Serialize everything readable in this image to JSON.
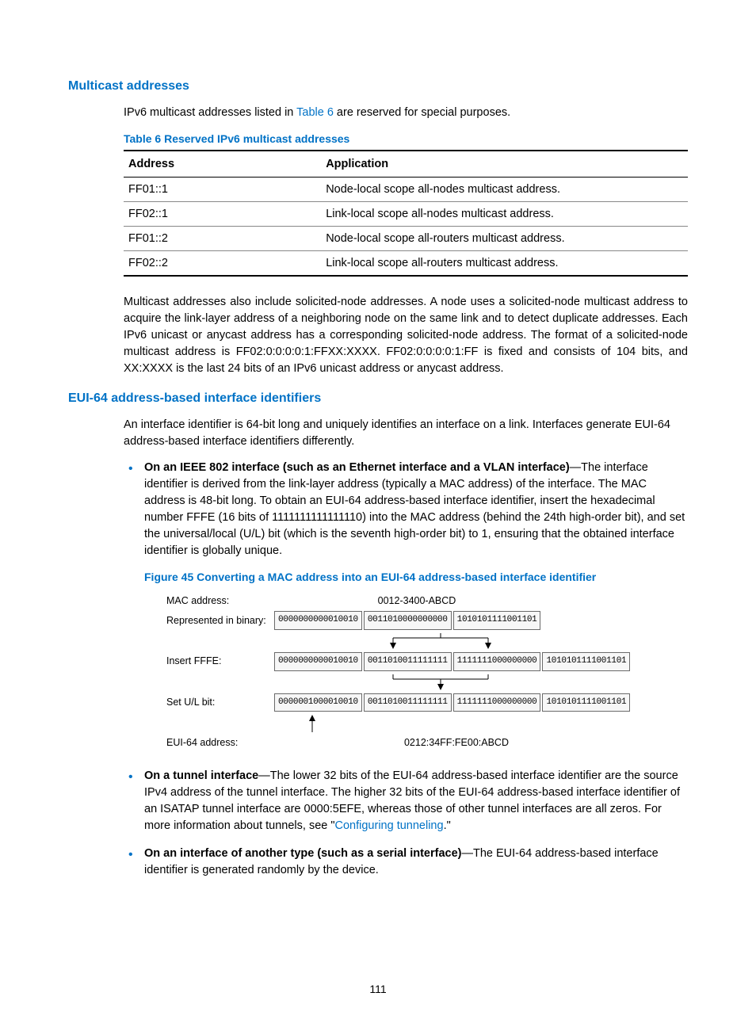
{
  "section1": {
    "title": "Multicast addresses",
    "intro_before": "IPv6 multicast addresses listed in ",
    "intro_link": "Table 6",
    "intro_after": " are reserved for special purposes.",
    "table_title": "Table 6 Reserved IPv6 multicast addresses",
    "table_headers": {
      "c0": "Address",
      "c1": "Application"
    },
    "rows": [
      {
        "addr": "FF01::1",
        "app": "Node-local scope all-nodes multicast address."
      },
      {
        "addr": "FF02::1",
        "app": "Link-local scope all-nodes multicast address."
      },
      {
        "addr": "FF01::2",
        "app": "Node-local scope all-routers multicast address."
      },
      {
        "addr": "FF02::2",
        "app": "Link-local scope all-routers multicast address."
      }
    ],
    "para2": "Multicast addresses also include solicited-node addresses. A node uses a solicited-node multicast address to acquire the link-layer address of a neighboring node on the same link and to detect duplicate addresses. Each IPv6 unicast or anycast address has a corresponding solicited-node address. The format of a solicited-node multicast address is FF02:0:0:0:0:1:FFXX:XXXX. FF02:0:0:0:0:1:FF is fixed and consists of 104 bits, and XX:XXXX is the last 24 bits of an IPv6 unicast address or anycast address."
  },
  "section2": {
    "title": "EUI-64 address-based interface identifiers",
    "intro": "An interface identifier is 64-bit long and uniquely identifies an interface on a link. Interfaces generate EUI-64 address-based interface identifiers differently.",
    "bullet1_bold": "On an IEEE 802 interface (such as an Ethernet interface and a VLAN interface)",
    "bullet1_rest": "—The interface identifier is derived from the link-layer address (typically a MAC address) of the interface. The MAC address is 48-bit long. To obtain an EUI-64 address-based interface identifier, insert the hexadecimal number FFFE (16 bits of 1111111111111110) into the MAC address (behind the 24th high-order bit), and set the universal/local (U/L) bit (which is the seventh high-order bit) to 1, ensuring that the obtained interface identifier is globally unique.",
    "figure_title": "Figure 45 Converting a MAC address into an EUI-64 address-based interface identifier",
    "fig": {
      "row_mac_label": "MAC address:",
      "row_mac_value": "0012-3400-ABCD",
      "row_bin_label": "Represented in binary:",
      "row_bin_boxes": [
        "0000000000010010",
        "0011010000000000",
        "1010101111001101"
      ],
      "row_fffe_label": "Insert FFFE:",
      "row_fffe_boxes": [
        "0000000000010010",
        "0011010011111111",
        "1111111000000000",
        "1010101111001101"
      ],
      "row_ul_label": "Set U/L bit:",
      "row_ul_boxes": [
        "0000001000010010",
        "0011010011111111",
        "1111111000000000",
        "1010101111001101"
      ],
      "row_eui_label": "EUI-64 address:",
      "row_eui_value": "0212:34FF:FE00:ABCD"
    },
    "bullet2_bold": "On a tunnel interface",
    "bullet2_rest_a": "—The lower 32 bits of the EUI-64 address-based interface identifier are the source IPv4 address of the tunnel interface. The higher 32 bits of the EUI-64 address-based interface identifier of an ISATAP tunnel interface are 0000:5EFE, whereas those of other tunnel interfaces are all zeros. For more information about tunnels, see \"",
    "bullet2_link": "Configuring tunneling",
    "bullet2_rest_b": ".\"",
    "bullet3_bold": "On an interface of another type (such as a serial interface)",
    "bullet3_rest": "—The EUI-64 address-based interface identifier is generated randomly by the device."
  },
  "page_number": "111"
}
